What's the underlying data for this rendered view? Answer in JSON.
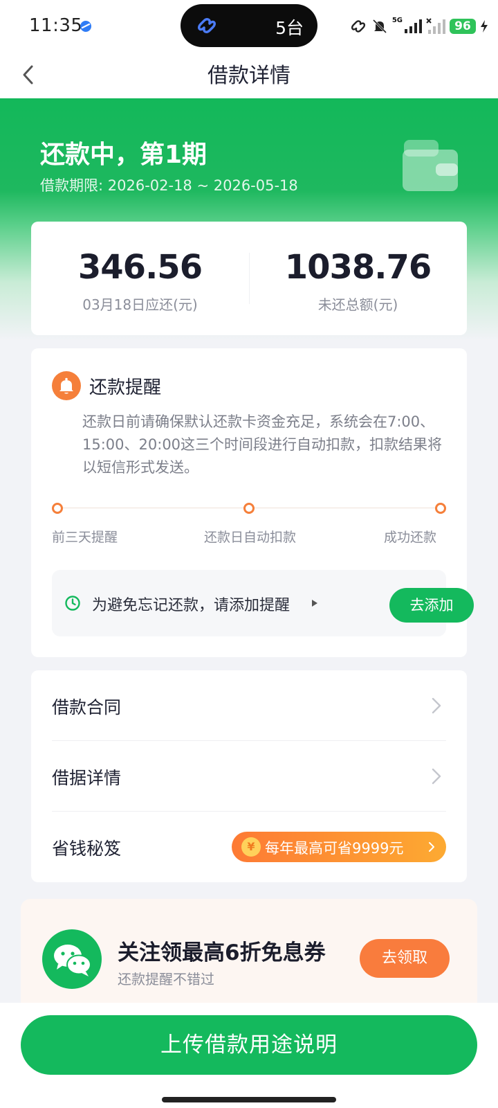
{
  "status_bar": {
    "time": "11:35",
    "island_text": "5台",
    "network": "5G",
    "battery": "96"
  },
  "nav": {
    "title": "借款详情"
  },
  "hero": {
    "status": "还款中，第1期",
    "period": "借款期限: 2026-02-18 ~ 2026-05-18"
  },
  "amounts": {
    "due": {
      "value": "346.56",
      "label": "03月18日应还(元)"
    },
    "outstanding": {
      "value": "1038.76",
      "label": "未还总额(元)"
    }
  },
  "reminder": {
    "title": "还款提醒",
    "text": "还款日前请确保默认还款卡资金充足，系统会在7:00、15:00、20:00这三个时间段进行自动扣款，扣款结果将以短信形式发送。",
    "steps": [
      "前三天提醒",
      "还款日自动扣款",
      "成功还款"
    ],
    "add_tip": "为避免忘记还款，请添加提醒",
    "add_button": "去添加"
  },
  "menu": {
    "items": [
      {
        "label": "借款合同"
      },
      {
        "label": "借据详情"
      },
      {
        "label": "省钱秘笈"
      }
    ],
    "save_badge": "每年最高可省9999元",
    "yen": "¥"
  },
  "promo": {
    "title": "关注领最高6折免息券",
    "subtitle": "还款提醒不错过",
    "button": "去领取"
  },
  "bottom": {
    "button": "上传借款用途说明"
  },
  "colors": {
    "brand_green": "#14b95d",
    "accent_orange": "#f57f3a"
  }
}
